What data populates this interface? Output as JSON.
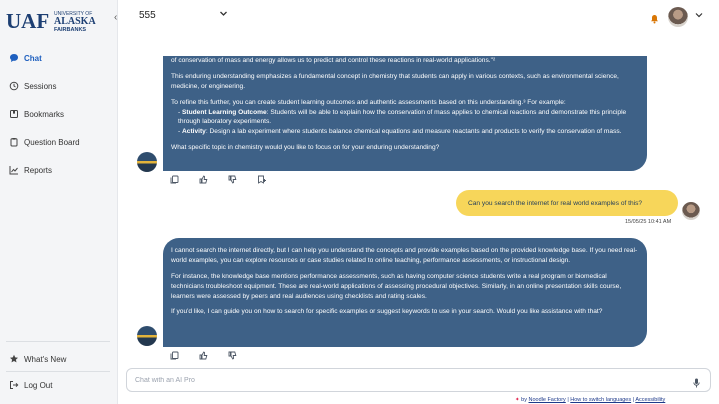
{
  "brand": {
    "line1": "UNIVERSITY OF",
    "line2": "ALASKA",
    "line3": "FAIRBANKS"
  },
  "sidebar": {
    "items": [
      {
        "label": "Chat",
        "icon": "chat-bubble-icon"
      },
      {
        "label": "Sessions",
        "icon": "history-icon"
      },
      {
        "label": "Bookmarks",
        "icon": "bookmark-icon"
      },
      {
        "label": "Question Board",
        "icon": "clipboard-icon"
      },
      {
        "label": "Reports",
        "icon": "line-chart-icon"
      }
    ],
    "bottom": [
      {
        "label": "What's New",
        "icon": "star-icon"
      },
      {
        "label": "Log Out",
        "icon": "logout-icon"
      }
    ]
  },
  "header": {
    "workspace": "555"
  },
  "messages": {
    "ai1": {
      "p0": "of conservation of mass and energy allows us to predict and control these reactions in real-world applications.\"²",
      "p1": "This enduring understanding emphasizes a fundamental concept in chemistry that students can apply in various contexts, such as environmental science, medicine, or engineering.",
      "p2": "To refine this further, you can create student learning outcomes and authentic assessments based on this understanding.³ For example:",
      "b1_label": "Student Learning Outcome",
      "b1_text": ": Students will be able to explain how the conservation of mass applies to chemical reactions and demonstrate this principle through laboratory experiments.",
      "b2_label": "Activity",
      "b2_text": ": Design a lab experiment where students balance chemical equations and measure reactants and products to verify the conservation of mass.",
      "p3": "What specific topic in chemistry would you like to focus on for your enduring understanding?"
    },
    "user1": {
      "text": "Can you search the internet for real world examples of this?",
      "timestamp": "15/05/25 10:41 AM"
    },
    "ai2": {
      "p1": "I cannot search the internet directly, but I can help you understand the concepts and provide examples based on the provided knowledge base. If you need real-world examples, you can explore resources or case studies related to online teaching, performance assessments, or instructional design.",
      "p2": "For instance, the knowledge base mentions performance assessments, such as having computer science students write a real program or biomedical technicians troubleshoot equipment. These are real-world applications of assessing procedural objectives. Similarly, in an online presentation skills course, learners were assessed by peers and real audiences using checklists and rating scales.",
      "p3": "If you'd like, I can guide you on how to search for specific examples or suggest keywords to use in your search. Would you like assistance with that?"
    }
  },
  "input": {
    "placeholder": "Chat with an AI Pro"
  },
  "footer": {
    "by": "by",
    "brand_link": "Noodle Factory",
    "sep": "|",
    "link2": "How to switch languages",
    "link3": "Accessibility"
  },
  "colors": {
    "ai_bubble": "#3e6187",
    "user_bubble": "#f7d65a",
    "accent": "#1e5fbf"
  }
}
